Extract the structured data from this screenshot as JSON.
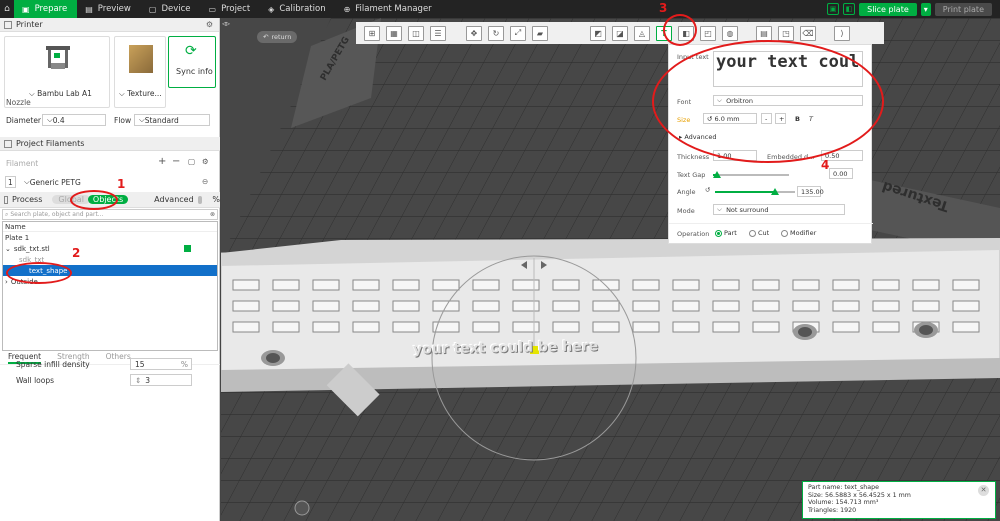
{
  "topbar": {
    "tabs": [
      {
        "label": "Prepare",
        "icon": "prepare-icon"
      },
      {
        "label": "Preview",
        "icon": "preview-icon"
      },
      {
        "label": "Device",
        "icon": "device-icon"
      },
      {
        "label": "Project",
        "icon": "project-icon"
      },
      {
        "label": "Calibration",
        "icon": "calibration-icon"
      },
      {
        "label": "Filament Manager",
        "icon": "filament-manager-icon"
      }
    ],
    "slice": "Slice plate",
    "print": "Print plate"
  },
  "printer": {
    "section": "Printer",
    "name": "Bambu Lab A1",
    "texture": "Texture...",
    "sync": "Sync info"
  },
  "nozzle": {
    "label": "Nozzle",
    "diameter_label": "Diameter",
    "diameter": "0.4",
    "flow_label": "Flow",
    "flow": "Standard"
  },
  "filaments": {
    "section": "Project Filaments",
    "subheader": "Filament",
    "slot": "1",
    "name": "Generic PETG"
  },
  "process": {
    "section": "Process",
    "global": "Global",
    "objects": "Objects",
    "advanced": "Advanced",
    "search_placeholder": "Search plate, object and part..."
  },
  "tree": {
    "header": "Name",
    "rows": [
      "Plate 1",
      "sdk_txt.stl",
      "sdk_txt",
      "text_shape",
      "Outside"
    ]
  },
  "settings": {
    "tabs": [
      "Frequent",
      "Strength",
      "Others"
    ],
    "sparse_label": "Sparse infill density",
    "sparse": "15",
    "sparse_unit": "%",
    "walls_label": "Wall loops",
    "walls": "3"
  },
  "canvas": {
    "return": "return",
    "model_text": "your text could be here",
    "plate_text": "Textured PEI Plate",
    "plate_label": "PLA/PETG",
    "texture_label": "Textured"
  },
  "textpanel": {
    "input_label": "Input text",
    "input_value": "your text coul",
    "font_label": "Font",
    "font": "Orbitron",
    "size_label": "Size",
    "size": "6.0 mm",
    "minus": "-",
    "plus": "+",
    "bold": "B",
    "italic": "T",
    "advanced": "Advanced",
    "thickness_label": "Thickness",
    "thickness": "1.00",
    "embedded_label": "Embedded d...",
    "embedded": "0.50",
    "gap_label": "Text Gap",
    "gap": "0.00",
    "gap_level": 0.05,
    "angle_label": "Angle",
    "angle": "135.00",
    "angle_level": 0.75,
    "mode_label": "Mode",
    "mode": "Not surround",
    "operation_label": "Operation",
    "ops": [
      "Part",
      "Cut",
      "Modifier"
    ]
  },
  "info": {
    "lines": [
      "Part name: text_shape",
      "Size: 56.5883 x 56.4525 x 1 mm",
      "Volume: 154.713 mm³",
      "Triangles: 1920"
    ]
  },
  "annotations": [
    "1",
    "2",
    "3",
    "4"
  ],
  "colors": {
    "accent": "#00ae42",
    "selection": "#1270c9",
    "annotation": "#e21b1b"
  }
}
